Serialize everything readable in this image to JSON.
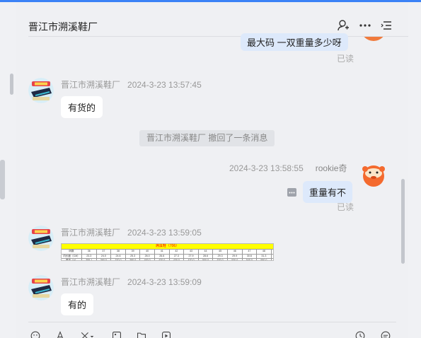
{
  "header": {
    "title": "晋江市溯溪鞋厂",
    "icons": [
      "person-icon",
      "more-icon",
      "menu-icon"
    ]
  },
  "messages": {
    "top_partial": {
      "text": "最大码  一双重量多少呀",
      "status": "已读"
    },
    "msg1": {
      "sender": "晋江市溯溪鞋厂",
      "time": "2024-3-23 13:57:45",
      "text": "有货的"
    },
    "recall": {
      "text": "晋江市溯溪鞋厂 撤回了一条消息"
    },
    "msg2": {
      "sender": "rookie奇",
      "time": "2024-3-23 13:58:55",
      "text": "重量有不",
      "status": "已读"
    },
    "msg3": {
      "sender": "晋江市溯溪鞋厂",
      "time": "2024-3-23 13:59:05",
      "image": {
        "title": "溯溪鞋（706）",
        "header_row": [
          "码数",
          "36",
          "37",
          "38",
          "39",
          "40",
          "41",
          "42",
          "43",
          "44",
          "45",
          "46",
          "47",
          "48"
        ],
        "row1_label": "内长度（CM）",
        "row1": [
          "23.3",
          "24.0",
          "24.6",
          "25.3",
          "26.0",
          "26.6",
          "27.3",
          "27.9",
          "28.6",
          "29.3",
          "29.9",
          "30.6",
          "31.3"
        ],
        "row2_label": "重量（g）",
        "row2": [
          "355.1",
          "360.0",
          "370.0",
          "380.0",
          "400.0",
          "420.0",
          "430.0",
          "470.0",
          "500.0",
          "520.0",
          "530.0",
          "540.0",
          "550.0"
        ]
      }
    },
    "msg4": {
      "sender": "晋江市溯溪鞋厂",
      "time": "2024-3-23 13:59:09",
      "text": "有的"
    }
  },
  "toolbar": {
    "icons": [
      "emoji-icon",
      "font-icon",
      "scissors-icon",
      "image-icon",
      "folder-icon",
      "video-icon",
      "history-icon",
      "quick-reply-icon"
    ]
  },
  "colors": {
    "accent": "#3b82f6",
    "bubble_self": "#dde9fb",
    "bubble_other": "#ffffff",
    "table_header": "#ffff00",
    "table_title": "#ff0000"
  }
}
